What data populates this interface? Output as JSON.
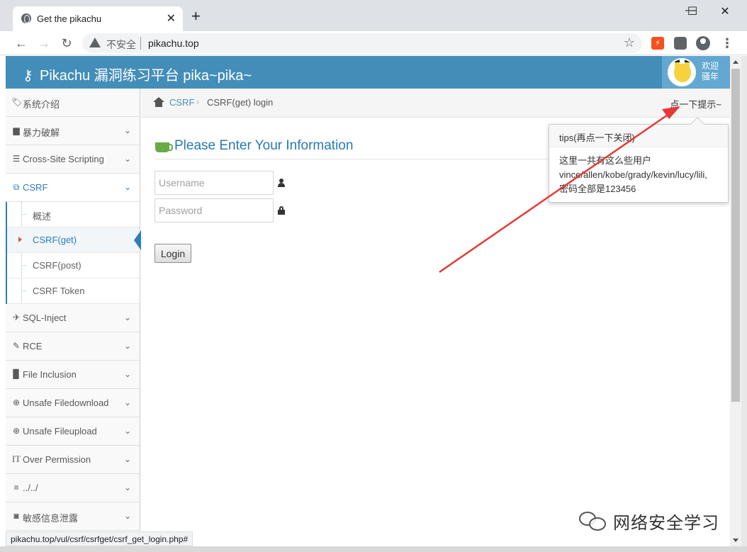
{
  "browser": {
    "tab_title": "Get the pikachu",
    "tab_close": "✕",
    "new_tab": "+",
    "win_minimize": "—",
    "win_maximize": "☐",
    "win_close": "✕",
    "security_label": "不安全",
    "url": "pikachu.top",
    "status_url": "pikachu.top/vul/csrf/csrfget/csrf_get_login.php#",
    "icons": [
      "globe-icon",
      "back-icon",
      "forward-icon",
      "reload-icon",
      "warning-icon",
      "star-icon",
      "extension-icon",
      "puzzle-icon",
      "profile-icon",
      "menu-icon"
    ]
  },
  "header": {
    "brand": "Pikachu 漏洞练习平台 pika~pika~",
    "user_line1": "欢迎",
    "user_line2": "骚年",
    "color": "#438eb9"
  },
  "sidebar": {
    "items": [
      {
        "label": "系统介绍",
        "icon": "tags-icon",
        "glyph": "🏷",
        "chev": ""
      },
      {
        "label": "暴力破解",
        "icon": "lock-icon",
        "glyph": "🔒",
        "chev": "⌄"
      },
      {
        "label": "Cross-Site Scripting",
        "icon": "indent-icon",
        "glyph": "☰",
        "chev": "⌄"
      },
      {
        "label": "CSRF",
        "icon": "share-icon",
        "glyph": "⧉",
        "chev": "⌄"
      }
    ],
    "csrf_sub": [
      {
        "label": "概述"
      },
      {
        "label": "CSRF(get)"
      },
      {
        "label": "CSRF(post)"
      },
      {
        "label": "CSRF Token"
      }
    ],
    "items_after": [
      {
        "label": "SQL-Inject",
        "icon": "plane-icon",
        "glyph": "✈",
        "chev": "⌄"
      },
      {
        "label": "RCE",
        "icon": "pencil-icon",
        "glyph": "✎",
        "chev": "⌄"
      },
      {
        "label": "File Inclusion",
        "icon": "file-icon",
        "glyph": "▉",
        "chev": "⌄"
      },
      {
        "label": "Unsafe Filedownload",
        "icon": "download-icon",
        "glyph": "⊕",
        "chev": "⌄"
      },
      {
        "label": "Unsafe Fileupload",
        "icon": "upload-icon",
        "glyph": "⊕",
        "chev": "⌄"
      },
      {
        "label": "Over Permission",
        "icon": "text-height-icon",
        "glyph": "IT",
        "chev": "⌄"
      },
      {
        "label": "../../",
        "icon": "align-left-icon",
        "glyph": "≡",
        "chev": "⌄"
      },
      {
        "label": "敏感信息泄露",
        "icon": "camera-icon",
        "glyph": "◙",
        "chev": "⌄"
      }
    ]
  },
  "breadcrumbs": {
    "parent": "CSRF",
    "separator": "›",
    "current": "CSRF(get) login",
    "hint_link": "点一下提示~"
  },
  "form": {
    "title": "Please Enter Your Information",
    "username_placeholder": "Username",
    "password_placeholder": "Password",
    "login_label": "Login"
  },
  "popover": {
    "title": "tips(再点一下关闭)",
    "line1": "这里一共有这么些用户",
    "line2": "vince/allen/kobe/grady/kevin/lucy/lili,",
    "line3": "密码全部是123456"
  },
  "watermark": {
    "text": "网络安全学习"
  },
  "colors": {
    "accent": "#2b7dbc",
    "arrow": "#e53935",
    "header": "#438eb9"
  }
}
